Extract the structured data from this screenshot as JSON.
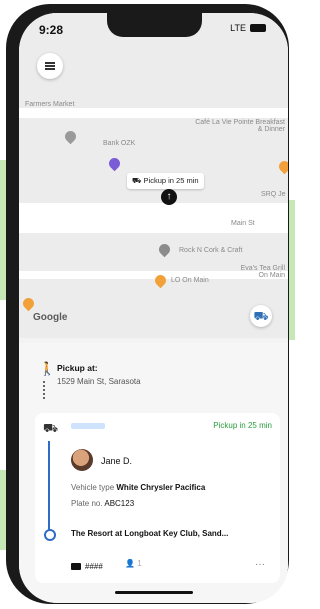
{
  "status": {
    "time": "9:28",
    "signal": "LTE"
  },
  "map": {
    "labels": {
      "farmers_market": "Farmers Market",
      "bank": "Bank OZK",
      "cafe": "Café La Vie Pointe Breakfast & Dinner",
      "srq": "SRQ Je",
      "main_st": "Main St",
      "rock": "Rock N Cork & Craft",
      "lo": "LO On Main",
      "eva": "Eva's Tea Grill On Main"
    },
    "pickup_bubble": "Pickup in 25 min",
    "google": "Google"
  },
  "sheet": {
    "pickup_title": "Pickup at:",
    "pickup_address": "1529 Main St, Sarasota",
    "eta": "Pickup in 25 min",
    "driver_name": "Jane D.",
    "vehicle_label": "Vehicle type",
    "vehicle_value": "White Chrysler Pacifica",
    "plate_label": "Plate no.",
    "plate_value": "ABC123",
    "destination": "The Resort at Longboat Key Club, Sand...",
    "payment": "####",
    "passengers": "1",
    "more": "···"
  },
  "icons": {
    "menu": "menu-icon",
    "walk": "walk-icon",
    "car": "car-icon",
    "locate": "locate-icon",
    "card": "card-icon",
    "person": "person-icon"
  },
  "colors": {
    "eta_green": "#2a9d3b",
    "route_blue": "#2e6cc8",
    "background_green": "#c5e8b6"
  }
}
